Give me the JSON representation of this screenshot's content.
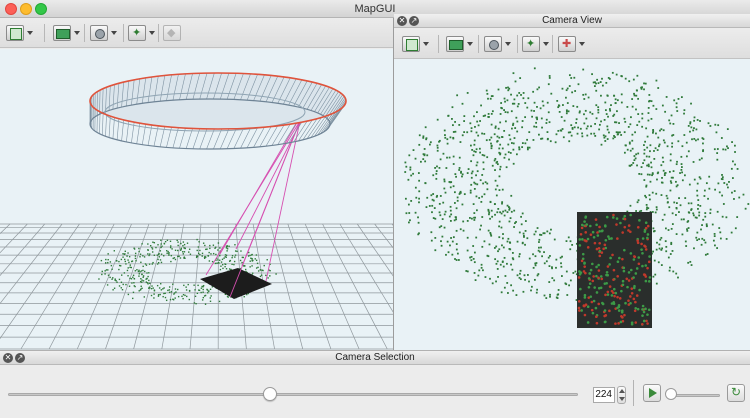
{
  "window": {
    "title": "MapGUI"
  },
  "left_toolbar": {
    "buttons": [
      {
        "icon": "fit-view-icon"
      },
      {
        "icon": "map-view-icon"
      },
      {
        "icon": "camera-view-icon"
      },
      {
        "icon": "points-view-icon"
      },
      {
        "icon": "mesh-view-icon"
      }
    ]
  },
  "camera_view": {
    "title": "Camera View",
    "buttons": [
      {
        "icon": "fit-view-icon"
      },
      {
        "icon": "map-view-icon"
      },
      {
        "icon": "camera-view-icon"
      },
      {
        "icon": "points-view-icon"
      },
      {
        "icon": "keyframe-view-icon"
      }
    ]
  },
  "camera_selection": {
    "title": "Camera Selection",
    "frame_value": "224",
    "slider_fraction": 0.46,
    "speed_fraction": 0.05
  },
  "colors": {
    "panel_bg": "#e9f2f6",
    "point_green": "#2f7a3a",
    "trajectory_red": "#e0533b",
    "frustum_magenta": "#d64fb0",
    "ring_gray": "#8fa4b3"
  }
}
